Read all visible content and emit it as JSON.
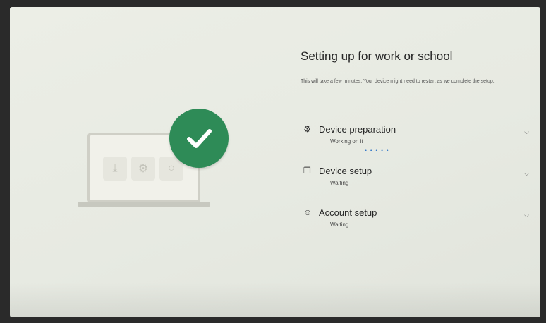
{
  "header": {
    "title": "Setting up for work or school",
    "subtitle": "This will take a few minutes. Your device might need to restart as we complete the setup."
  },
  "steps": [
    {
      "label": "Device preparation",
      "status": "Working on it",
      "icon": "gear-icon",
      "expanded": false,
      "in_progress": true
    },
    {
      "label": "Device setup",
      "status": "Waiting",
      "icon": "device-copy-icon",
      "expanded": false,
      "in_progress": false
    },
    {
      "label": "Account setup",
      "status": "Waiting",
      "icon": "people-icon",
      "expanded": false,
      "in_progress": false
    }
  ],
  "progress_indicator": "• • • • •",
  "colors": {
    "accent_green": "#2e8b57",
    "progress_blue": "#2b72c6",
    "background": "#e9ebe4"
  }
}
